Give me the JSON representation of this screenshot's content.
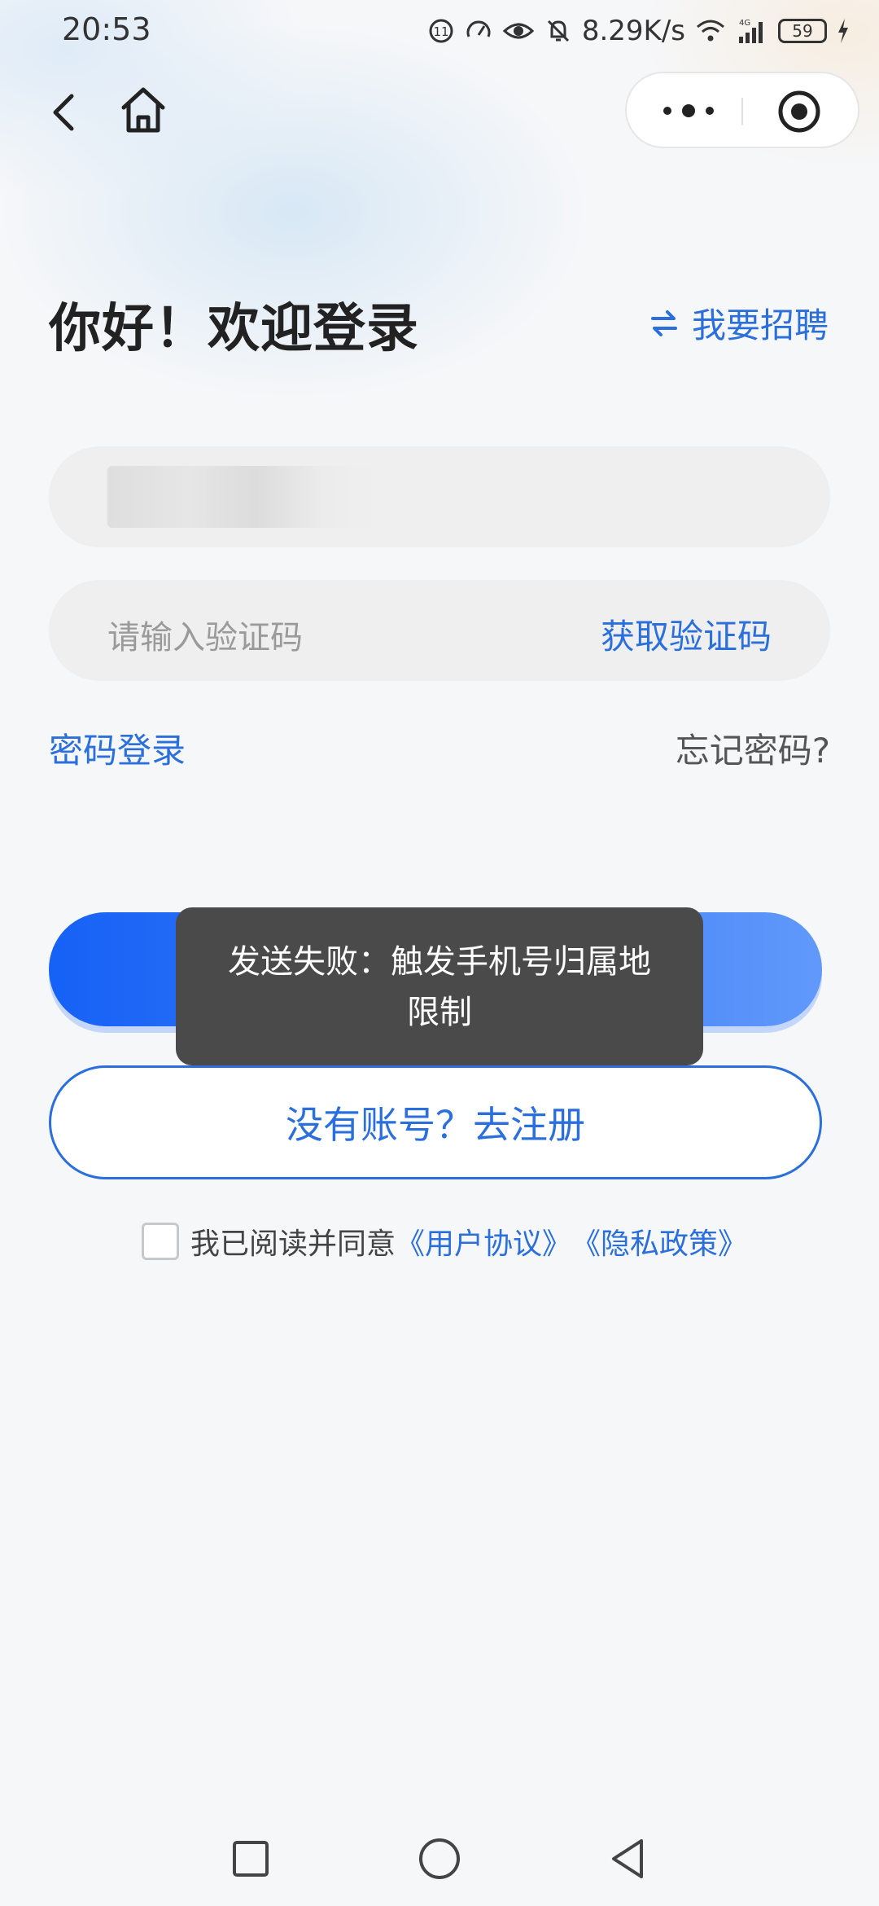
{
  "status_bar": {
    "time": "20:53",
    "net_speed": "8.29K/s",
    "battery": "59",
    "network_type": "4G",
    "icons": [
      "data-saver-icon",
      "speed-meter-icon",
      "eye-icon",
      "mute-bell-icon",
      "wifi-icon",
      "signal-icon",
      "battery-icon",
      "charging-icon"
    ]
  },
  "nav": {
    "icons": [
      "back-arrow-icon",
      "home-icon",
      "more-dots-icon",
      "close-target-icon"
    ]
  },
  "header": {
    "title": "你好！欢迎登录",
    "switch_link": "我要招聘",
    "switch_icon": "switch-arrows-icon"
  },
  "form": {
    "phone_value": "1",
    "code_placeholder": "请输入验证码",
    "get_code_label": "获取验证码",
    "password_login_label": "密码登录",
    "forgot_password_label": "忘记密码?"
  },
  "toast": {
    "message": "发送失败：触发手机号归属地限制"
  },
  "register_button": "没有账号？去注册",
  "agreement": {
    "prefix": "我已阅读并同意",
    "user_agreement": "《用户协议》",
    "privacy_policy": "《隐私政策》",
    "checked": false
  },
  "colors": {
    "accent": "#2a6fdb",
    "login_gradient_start": "#1661f6",
    "login_gradient_end": "#6199fb",
    "toast_bg": "#4a4a4a",
    "page_bg": "#f6f7f9"
  },
  "system_nav": {
    "icons": [
      "recents-square-icon",
      "home-circle-icon",
      "back-triangle-icon"
    ]
  }
}
